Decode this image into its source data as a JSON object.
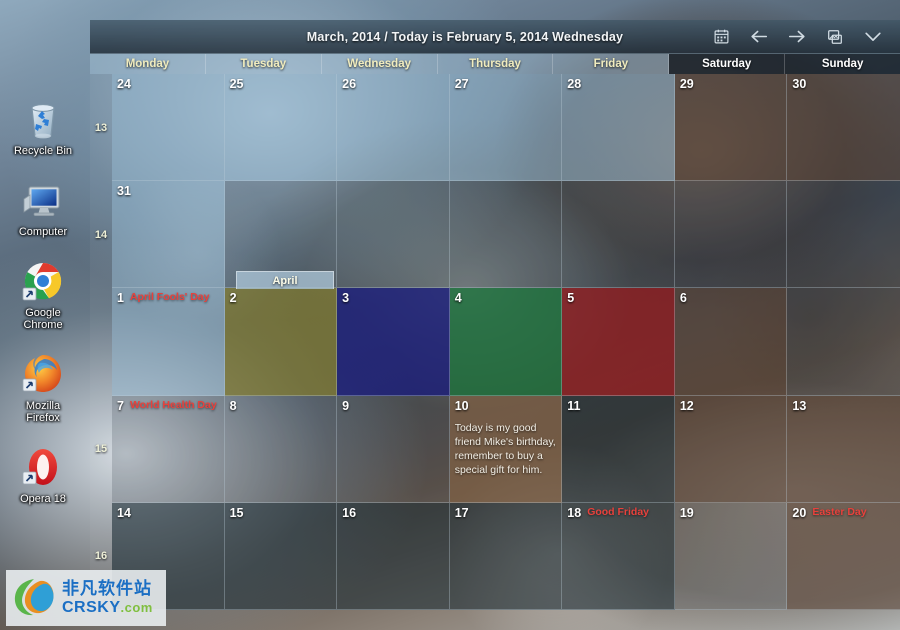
{
  "desktop": {
    "icons": [
      {
        "label": "Recycle Bin",
        "icon": "recycle-bin-icon"
      },
      {
        "label": "Computer",
        "icon": "computer-icon"
      },
      {
        "label": "Google\nChrome",
        "icon": "google-chrome-icon"
      },
      {
        "label": "Mozilla\nFirefox",
        "icon": "mozilla-firefox-icon"
      },
      {
        "label": "Opera 18",
        "icon": "opera-icon"
      }
    ]
  },
  "calendar": {
    "title": "March, 2014 / Today is February 5, 2014 Wednesday",
    "month_tab_label": "April",
    "toolbar": [
      {
        "name": "calendar-icon",
        "label": "Calendar"
      },
      {
        "name": "arrow-left-icon",
        "label": "Previous"
      },
      {
        "name": "arrow-right-icon",
        "label": "Next"
      },
      {
        "name": "screen-icon",
        "label": "Wallpaper"
      },
      {
        "name": "chevron-down-icon",
        "label": "More"
      }
    ],
    "weekdays": [
      {
        "label": "Monday",
        "weekend": false
      },
      {
        "label": "Tuesday",
        "weekend": false
      },
      {
        "label": "Wednesday",
        "weekend": false
      },
      {
        "label": "Thursday",
        "weekend": false
      },
      {
        "label": "Friday",
        "weekend": false
      },
      {
        "label": "Saturday",
        "weekend": true
      },
      {
        "label": "Sunday",
        "weekend": true
      }
    ],
    "week_numbers": [
      "13",
      "14",
      "15",
      "16"
    ],
    "weeks": [
      {
        "week": "13",
        "days": [
          {
            "day": "24",
            "holiday": "",
            "note": "",
            "tint": "t-lightblue"
          },
          {
            "day": "25",
            "holiday": "",
            "note": "",
            "tint": "t-lightblue"
          },
          {
            "day": "26",
            "holiday": "",
            "note": "",
            "tint": "t-lightblue"
          },
          {
            "day": "27",
            "holiday": "",
            "note": "",
            "tint": "t-lightblue"
          },
          {
            "day": "28",
            "holiday": "",
            "note": "",
            "tint": "t-lightblue"
          },
          {
            "day": "29",
            "holiday": "",
            "note": "",
            "tint": "t-brown"
          },
          {
            "day": "30",
            "holiday": "",
            "note": "",
            "tint": "t-brown"
          }
        ]
      },
      {
        "week": "14",
        "days": [
          {
            "day": "31",
            "holiday": "",
            "note": "",
            "tint": "t-lightblue"
          },
          {
            "day": "",
            "holiday": "",
            "note": "",
            "tint": "t-dim"
          },
          {
            "day": "",
            "holiday": "",
            "note": "",
            "tint": "t-dim"
          },
          {
            "day": "",
            "holiday": "",
            "note": "",
            "tint": "t-dim"
          },
          {
            "day": "",
            "holiday": "",
            "note": "",
            "tint": "t-dim"
          },
          {
            "day": "",
            "holiday": "",
            "note": "",
            "tint": "t-dim"
          },
          {
            "day": "",
            "holiday": "",
            "note": "",
            "tint": "t-dim"
          }
        ]
      },
      {
        "week": "14b",
        "days": [
          {
            "day": "1",
            "holiday": "April Fools' Day",
            "note": "",
            "tint": "t-lightblue"
          },
          {
            "day": "2",
            "holiday": "",
            "note": "",
            "tint": "t-olive"
          },
          {
            "day": "3",
            "holiday": "",
            "note": "",
            "tint": "t-blue"
          },
          {
            "day": "4",
            "holiday": "",
            "note": "",
            "tint": "t-green"
          },
          {
            "day": "5",
            "holiday": "",
            "note": "",
            "tint": "t-red"
          },
          {
            "day": "6",
            "holiday": "",
            "note": "",
            "tint": "t-brown"
          },
          {
            "day": "",
            "holiday": "",
            "note": "",
            "tint": "t-dim"
          }
        ]
      },
      {
        "week": "15",
        "days": [
          {
            "day": "7",
            "holiday": "World Health Day",
            "note": "",
            "tint": "t-dim"
          },
          {
            "day": "8",
            "holiday": "",
            "note": "",
            "tint": "t-dim"
          },
          {
            "day": "9",
            "holiday": "",
            "note": "",
            "tint": "t-dim"
          },
          {
            "day": "10",
            "holiday": "",
            "note": "Today is my good friend Mike's birthday,\nremember to buy a special gift for him.",
            "tint": "t-tan"
          },
          {
            "day": "11",
            "holiday": "",
            "note": "",
            "tint": "t-dark"
          },
          {
            "day": "12",
            "holiday": "",
            "note": "",
            "tint": "t-brown"
          },
          {
            "day": "13",
            "holiday": "",
            "note": "",
            "tint": "t-brown"
          }
        ]
      },
      {
        "week": "16",
        "days": [
          {
            "day": "14",
            "holiday": "",
            "note": "",
            "tint": "t-dark"
          },
          {
            "day": "15",
            "holiday": "",
            "note": "",
            "tint": "t-dark"
          },
          {
            "day": "16",
            "holiday": "",
            "note": "",
            "tint": "t-dark"
          },
          {
            "day": "17",
            "holiday": "",
            "note": "",
            "tint": "t-dark"
          },
          {
            "day": "18",
            "holiday": "Good Friday",
            "note": "",
            "tint": "t-dark"
          },
          {
            "day": "19",
            "holiday": "",
            "note": "",
            "tint": "t-dim"
          },
          {
            "day": "20",
            "holiday": "Easter Day",
            "note": "",
            "tint": "t-brown"
          }
        ]
      }
    ]
  },
  "watermark": {
    "chinese": "非凡软件站",
    "brand": "CRSKY",
    "suffix": ".com"
  },
  "colors": {
    "holiday_red": "#e8413c",
    "weekday_text": "#f0ecbe",
    "weekend_text": "#ffffff",
    "day_number": "#ffffff",
    "watermark_blue": "#1b6fc4",
    "watermark_green": "#7fbf3f"
  }
}
